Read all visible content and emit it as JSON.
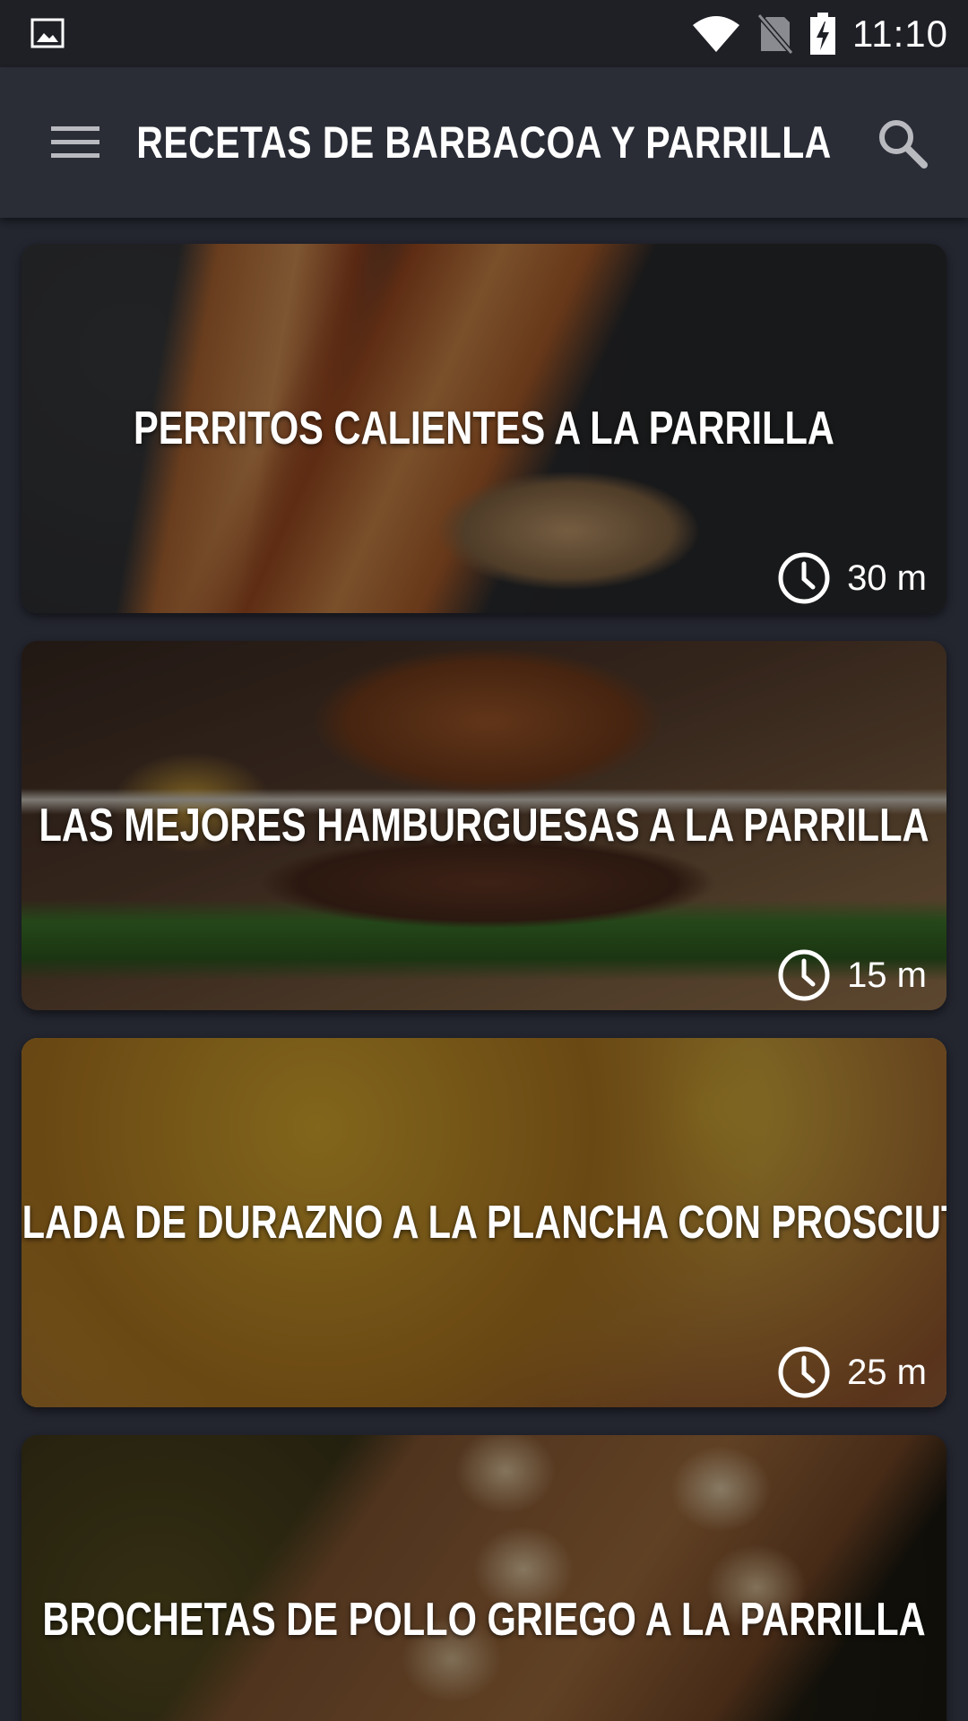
{
  "status_bar": {
    "time": "11:10",
    "icons": [
      "image-icon",
      "wifi-icon",
      "no-sim-icon",
      "battery-charging-icon"
    ]
  },
  "app_bar": {
    "title": "RECETAS DE BARBACOA Y PARRILLA",
    "icons": [
      "menu-icon",
      "search-icon"
    ]
  },
  "recipes": [
    {
      "title": "PERRITOS CALIENTES A LA PARRILLA",
      "time": "30 m"
    },
    {
      "title": "LAS MEJORES HAMBURGUESAS A LA PARRILLA",
      "time": "15 m"
    },
    {
      "title": "ENSALADA DE DURAZNO A LA PLANCHA CON PROSCIUTTO Y",
      "time": "25 m"
    },
    {
      "title": "BROCHETAS DE POLLO GRIEGO A LA PARRILLA",
      "time": ""
    }
  ],
  "colors": {
    "background": "#23252f",
    "status_bar": "#1f2026",
    "app_bar": "#2a2c36",
    "text": "#ffffff"
  }
}
